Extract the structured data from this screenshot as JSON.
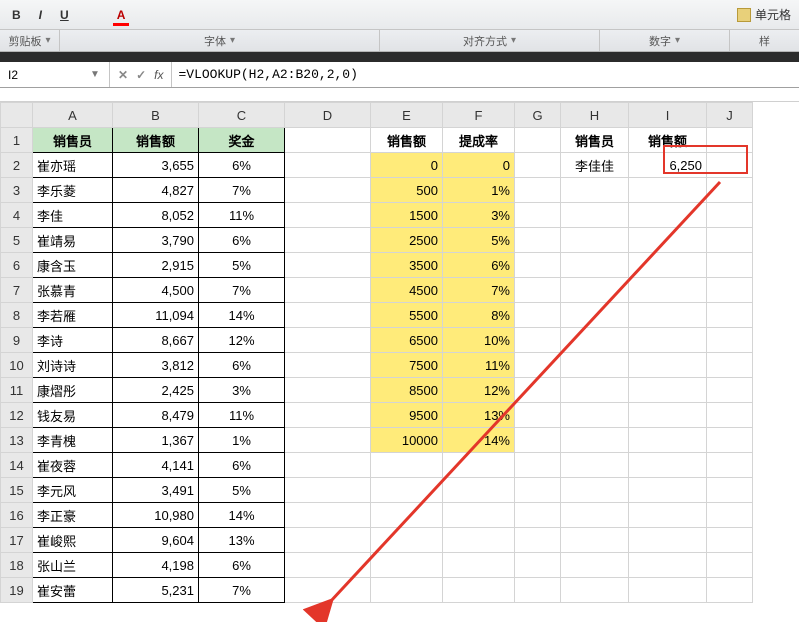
{
  "ribbon": {
    "b": "B",
    "i": "I",
    "u": "U",
    "a": "A",
    "clip": "剪贴板",
    "font": "字体",
    "align": "对齐方式",
    "number": "数字",
    "style": "样",
    "cellfmt": "单元格"
  },
  "fx": {
    "cellref": "I2",
    "formula": "=VLOOKUP(H2,A2:B20,2,0)",
    "fx_label": "fx"
  },
  "cols": [
    "A",
    "B",
    "C",
    "D",
    "E",
    "F",
    "G",
    "H",
    "I",
    "J"
  ],
  "headersABC": {
    "a": "销售员",
    "b": "销售额",
    "c": "奖金"
  },
  "headersEF": {
    "e": "销售额",
    "f": "提成率"
  },
  "headersHI": {
    "h": "销售员",
    "i": "销售额"
  },
  "dataABC": [
    {
      "name": "崔亦瑶",
      "amt": "3,655",
      "bon": "6%"
    },
    {
      "name": "李乐菱",
      "amt": "4,827",
      "bon": "7%"
    },
    {
      "name": "李佳",
      "amt": "8,052",
      "bon": "11%"
    },
    {
      "name": "崔靖易",
      "amt": "3,790",
      "bon": "6%"
    },
    {
      "name": "康含玉",
      "amt": "2,915",
      "bon": "5%"
    },
    {
      "name": "张慕青",
      "amt": "4,500",
      "bon": "7%"
    },
    {
      "name": "李若雁",
      "amt": "11,094",
      "bon": "14%"
    },
    {
      "name": "李诗",
      "amt": "8,667",
      "bon": "12%"
    },
    {
      "name": "刘诗诗",
      "amt": "3,812",
      "bon": "6%"
    },
    {
      "name": "康熠彤",
      "amt": "2,425",
      "bon": "3%"
    },
    {
      "name": "钱友易",
      "amt": "8,479",
      "bon": "11%"
    },
    {
      "name": "李青槐",
      "amt": "1,367",
      "bon": "1%"
    },
    {
      "name": "崔夜蓉",
      "amt": "4,141",
      "bon": "6%"
    },
    {
      "name": "李元风",
      "amt": "3,491",
      "bon": "5%"
    },
    {
      "name": "李正豪",
      "amt": "10,980",
      "bon": "14%"
    },
    {
      "name": "崔峻熙",
      "amt": "9,604",
      "bon": "13%"
    },
    {
      "name": "张山兰",
      "amt": "4,198",
      "bon": "6%"
    },
    {
      "name": "崔安蕾",
      "amt": "5,231",
      "bon": "7%"
    }
  ],
  "dataEF": [
    {
      "e": "0",
      "f": "0"
    },
    {
      "e": "500",
      "f": "1%"
    },
    {
      "e": "1500",
      "f": "3%"
    },
    {
      "e": "2500",
      "f": "5%"
    },
    {
      "e": "3500",
      "f": "6%"
    },
    {
      "e": "4500",
      "f": "7%"
    },
    {
      "e": "5500",
      "f": "8%"
    },
    {
      "e": "6500",
      "f": "10%"
    },
    {
      "e": "7500",
      "f": "11%"
    },
    {
      "e": "8500",
      "f": "12%"
    },
    {
      "e": "9500",
      "f": "13%"
    },
    {
      "e": "10000",
      "f": "14%"
    }
  ],
  "lookup": {
    "h": "李佳佳",
    "i": "6,250"
  }
}
